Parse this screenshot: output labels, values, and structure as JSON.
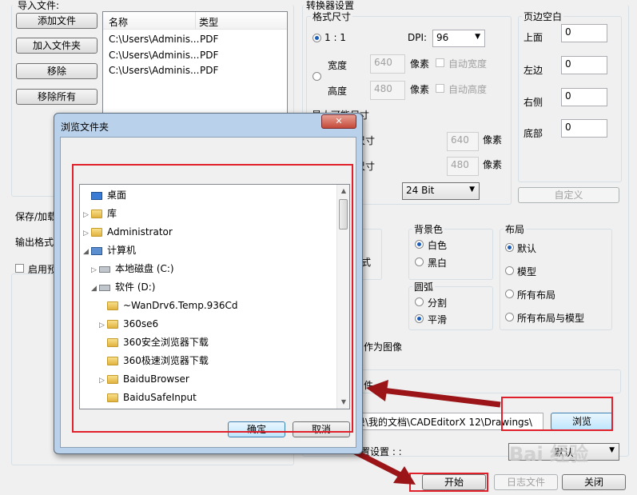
{
  "import": {
    "title": "导入文件:",
    "add_file": "添加文件",
    "add_folder": "加入文件夹",
    "remove": "移除",
    "remove_all": "移除所有",
    "columns": {
      "name": "名称",
      "type": "类型"
    },
    "files": [
      {
        "name": "C:\\Users\\Adminis...",
        "type": "PDF"
      },
      {
        "name": "C:\\Users\\Adminis...",
        "type": "PDF"
      },
      {
        "name": "C:\\Users\\Adminis...",
        "type": "PDF"
      }
    ],
    "save_load_label": "保存/加载",
    "output_format_label": "输出格式",
    "enable_preview_label": "启用预"
  },
  "converter": {
    "title": "转换器设置",
    "format_size": {
      "title": "格式尺寸",
      "ratio_label": "1 : 1",
      "dpi_label": "DPI:",
      "dpi_value": "96",
      "width_label": "宽度",
      "width_value": "640",
      "height_label": "高度",
      "height_value": "480",
      "pixels_label": "像素",
      "auto_width": "自动宽度",
      "auto_height": "自动高度",
      "max_size_label": "最大可能尺寸",
      "size_w_suffix": "尺寸",
      "size_h_suffix": "尺寸",
      "max_w_value": "640",
      "max_h_value": "480",
      "bit_depth": "24 Bit"
    },
    "margins": {
      "title": "页边空白",
      "top": "上面",
      "top_value": "0",
      "left": "左边",
      "left_value": "0",
      "right": "右侧",
      "right_value": "0",
      "bottom": "底部",
      "bottom_value": "0",
      "custom_button": "自定义"
    },
    "background": {
      "title": "背景色",
      "white": "白色",
      "black": "黑白"
    },
    "arc": {
      "title": "圆弧",
      "segment": "分割",
      "smooth": "平滑"
    },
    "layout": {
      "title": "布局",
      "default": "默认",
      "model": "模型",
      "all_layouts": "所有布局",
      "all_layouts_model": "所有布局与模型"
    },
    "partial_style": "式",
    "as_image": "作为图像",
    "partial_file": "件"
  },
  "output": {
    "path_value": "录\\我的文档\\CADEditorX 12\\Drawings\\",
    "browse_button": "浏览",
    "settings_label": "置设置 : :",
    "settings_value": "默认",
    "start_button": "开始",
    "log_button": "日志文件",
    "close_button": "关闭"
  },
  "dialog": {
    "title": "浏览文件夹",
    "close_glyph": "✕",
    "ok_button": "确定",
    "cancel_button": "取消",
    "tree": [
      {
        "label": "桌面"
      },
      {
        "label": "库"
      },
      {
        "label": "Administrator"
      },
      {
        "label": "计算机"
      },
      {
        "label": "本地磁盘 (C:)"
      },
      {
        "label": "软件 (D:)"
      },
      {
        "label": "~WanDrv6.Temp.936Cd"
      },
      {
        "label": "360se6"
      },
      {
        "label": "360安全浏览器下载"
      },
      {
        "label": "360极速浏览器下载"
      },
      {
        "label": "BaiduBrowser"
      },
      {
        "label": "BaiduSafeInput"
      }
    ]
  },
  "watermark": "Bai 经验",
  "colors": {
    "accent_red": "#e0202a",
    "arrow": "#9a1418",
    "dialog_frame": "#b9d1ea"
  }
}
